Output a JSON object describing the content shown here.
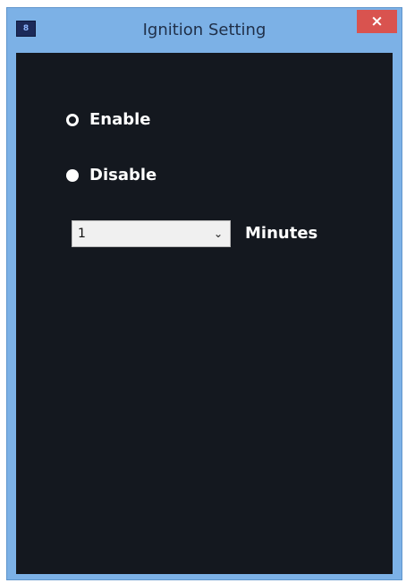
{
  "window": {
    "app_icon_text": "8",
    "title": "Ignition Setting",
    "close_symbol": "×"
  },
  "options": {
    "enable_label": "Enable",
    "disable_label": "Disable",
    "selected_option": "Enable"
  },
  "timer": {
    "value": "1",
    "unit": "Minutes"
  }
}
